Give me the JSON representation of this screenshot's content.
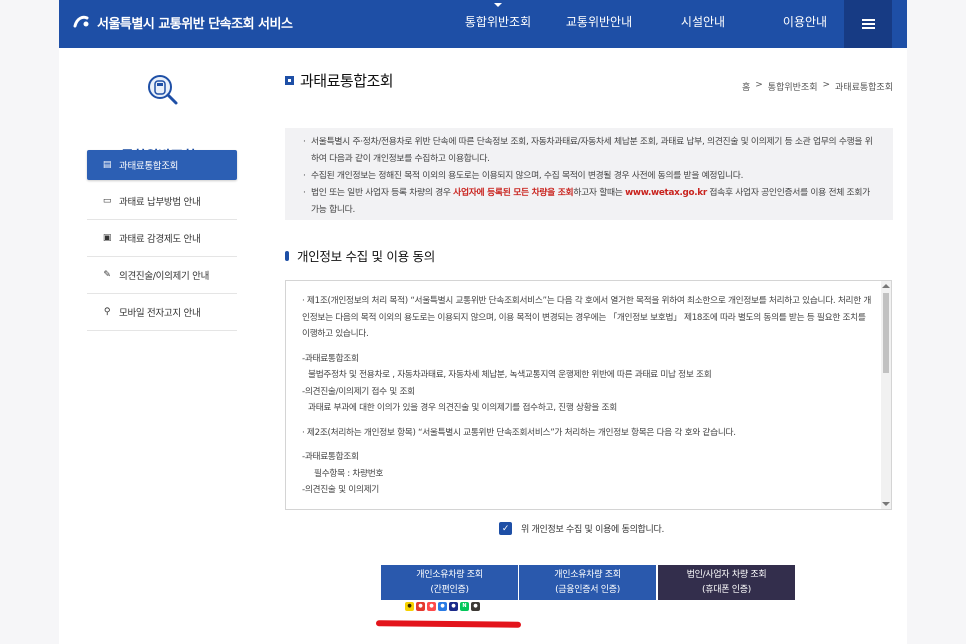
{
  "header": {
    "logo_text": "서울특별시 교통위반 단속조회 서비스",
    "nav": [
      "통합위반조회",
      "교통위반안내",
      "시설안내",
      "이용안내"
    ]
  },
  "sidebar": {
    "title": "통합위반조회",
    "items": [
      {
        "label": "과태료통합조회",
        "icon": "stack-icon"
      },
      {
        "label": "과태료 납부방법 안내",
        "icon": "card-icon"
      },
      {
        "label": "과태료 감경제도 안내",
        "icon": "document-icon"
      },
      {
        "label": "의견진술/이의제기 안내",
        "icon": "edit-document-icon"
      },
      {
        "label": "모바일 전자고지 안내",
        "icon": "search-icon"
      }
    ]
  },
  "main": {
    "title": "과태료통합조회",
    "breadcrumb": [
      "홈",
      "통합위반조회",
      "과태료통합조회"
    ],
    "notice": {
      "line1": "서울특별시 주·정차/전용차로 위반 단속에 따른 단속정보 조회, 자동차과태료/자동차세 체납분 조회, 과태료 납부, 의견진술 및 이의제기 등 소관 업무의 수행을 위하여 다음과 같이 개인정보를 수집하고 이용합니다.",
      "line2": "수집된 개인정보는 정해진 목적 이외의 용도로는 이용되지 않으며, 수집 목적이 변경될 경우 사전에 동의를 받을 예정입니다.",
      "line3_a": "법인 또는 일반 사업자 등록 차량의 경우",
      "line3_hl1": "사업자에 등록된 모든 차량을 조회",
      "line3_b": "하고자 할때는",
      "line3_hl2": "www.wetax.go.kr",
      "line3_c": "접속후 사업자 공인인증서를 이용 전체 조회가 가능 합니다."
    },
    "section_title": "개인정보 수집 및 이용 동의",
    "terms": {
      "p1": "· 제1조(개인정보의 처리 목적) “서울특별시 교통위반 단속조회서비스”는 다음 각 호에서 열거한 목적을 위하여 최소한으로 개인정보를 처리하고 있습니다. 처리한 개인정보는 다음의 목적 이외의 용도로는 이용되지 않으며, 이용 목적이 변경되는 경우에는 「개인정보 보호법」 제18조에 따라 별도의 동의를 받는 등 필요한 조치를 이행하고 있습니다.",
      "p2_head": "-과태료통합조회",
      "p2_body": "불법주정차 및 전용차로 , 자동차과태료, 자동차세 체납분, 녹색교통지역 운행제한 위반에 따른 과태료 미납 정보 조회",
      "p3_head": "-의견진술/이의제기 접수 및 조회",
      "p3_body": "과태료 부과에 대한 이의가 있을 경우 의견진술 및 이의제기를 접수하고, 진행 상황을 조회",
      "p4": "· 제2조(처리하는 개인정보 항목) “서울특별시 교통위반 단속조회서비스”가 처리하는 개인정보 항목은 다음 각 호와 같습니다.",
      "p5_head": "-과태료통합조회",
      "p5_body": "필수항목 : 차량번호",
      "p6_head": "-의견진술 및 이의제기"
    },
    "agree_label": "위 개인정보 수집 및 이용에 동의합니다.",
    "buttons": [
      {
        "line1": "개인소유차량 조회",
        "line2": "(간편인증)"
      },
      {
        "line1": "개인소유차량 조회",
        "line2": "(금융인증서 인증)"
      },
      {
        "line1": "법인/사업자 차량 조회",
        "line2": "(휴대폰 인증)"
      }
    ],
    "cert_icons": [
      "kakao-icon",
      "pass-icon",
      "payco-icon",
      "toss-icon",
      "samsung-icon",
      "naver-icon",
      "kb-icon"
    ]
  },
  "colors": {
    "brand": "#1e4fa6",
    "highlight": "#c9231e",
    "annotation": "#e3141b",
    "dark_button": "#332e4c"
  }
}
